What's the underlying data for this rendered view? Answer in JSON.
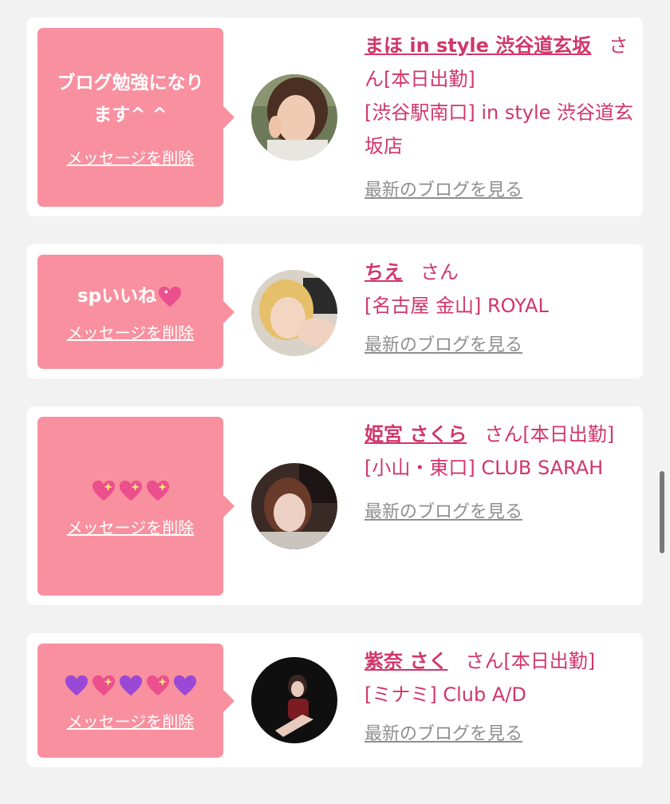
{
  "colors": {
    "background": "#f2f2f2",
    "bubble": "#f8909f",
    "accent": "#d1366a",
    "link_gray": "#8f8f8f"
  },
  "cards": [
    {
      "message": "ブログ勉強になります^ ^",
      "delete_label": "メッセージを削除",
      "name": "まほ in style 渋谷道玄坂",
      "suffix": "さん[本日出勤]",
      "shop": "[渋谷駅南口] in style 渋谷道玄坂店",
      "blog_link": "最新のブログを見る",
      "avatar_icon": "profile-photo"
    },
    {
      "message": "spいいね",
      "message_icons": [
        "sparkling-heart-icon"
      ],
      "delete_label": "メッセージを削除",
      "name": "ちえ",
      "suffix": "さん",
      "shop": "[名古屋 金山] ROYAL",
      "blog_link": "最新のブログを見る",
      "avatar_icon": "profile-photo"
    },
    {
      "message_icons": [
        "sparkling-heart-icon",
        "sparkling-heart-icon",
        "sparkling-heart-icon"
      ],
      "delete_label": "メッセージを削除",
      "name": "姫宮 さくら",
      "suffix": "さん[本日出勤]",
      "shop": "[小山・東口] CLUB SARAH",
      "blog_link": "最新のブログを見る",
      "avatar_icon": "profile-photo"
    },
    {
      "message_icons": [
        "purple-heart-icon",
        "sparkling-heart-icon",
        "purple-heart-icon",
        "sparkling-heart-icon",
        "purple-heart-icon"
      ],
      "delete_label": "メッセージを削除",
      "name": "紫奈 さく",
      "suffix": "さん[本日出勤]",
      "shop": "[ミナミ] Club A/D",
      "blog_link": "最新のブログを見る",
      "avatar_icon": "profile-photo"
    }
  ]
}
